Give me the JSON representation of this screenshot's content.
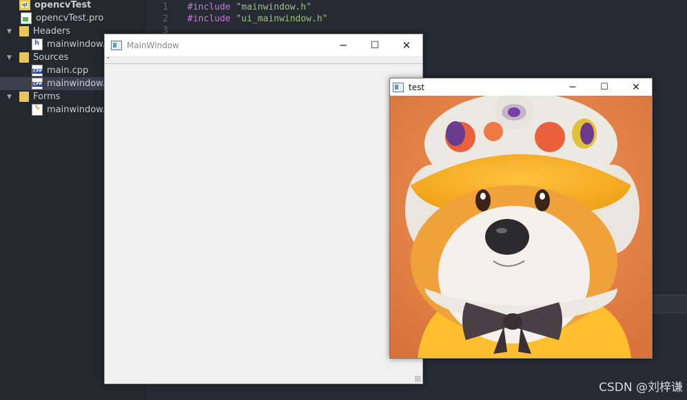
{
  "ide": {
    "tree": [
      {
        "label": "opencvTest",
        "type": "project",
        "bold": true,
        "indent": 0,
        "arrow": ""
      },
      {
        "label": "opencvTest.pro",
        "type": "pro",
        "indent": 1,
        "arrow": ""
      },
      {
        "label": "Headers",
        "type": "folder",
        "indent": 0,
        "arrow": "▼"
      },
      {
        "label": "mainwindow.h",
        "type": "header",
        "indent": 2,
        "arrow": ""
      },
      {
        "label": "Sources",
        "type": "folder",
        "indent": 0,
        "arrow": "▼"
      },
      {
        "label": "main.cpp",
        "type": "cpp",
        "indent": 2,
        "arrow": ""
      },
      {
        "label": "mainwindow.cpp",
        "type": "cpp",
        "indent": 2,
        "arrow": "",
        "selected": true
      },
      {
        "label": "Forms",
        "type": "folder",
        "indent": 0,
        "arrow": "▼"
      },
      {
        "label": "mainwindow.ui",
        "type": "ui",
        "indent": 2,
        "arrow": ""
      }
    ],
    "code": [
      {
        "line": "1",
        "keyword": "#include",
        "text": "\"mainwindow.h\""
      },
      {
        "line": "2",
        "keyword": "#include",
        "text": "\"ui_mainwindow.h\""
      },
      {
        "line": "3",
        "keyword": "",
        "text": ""
      }
    ]
  },
  "main_window": {
    "title": "MainWindow",
    "minimize_icon": "─",
    "maximize_icon": "☐",
    "close_icon": "✕"
  },
  "test_window": {
    "title": "test",
    "minimize_icon": "─",
    "maximize_icon": "☐",
    "close_icon": "✕"
  },
  "watermark": "CSDN @刘梓谦",
  "colors": {
    "ide_bg": "#262a33",
    "keyword": "#c678dd",
    "string": "#98c379",
    "image_bg": "#e7884a"
  }
}
